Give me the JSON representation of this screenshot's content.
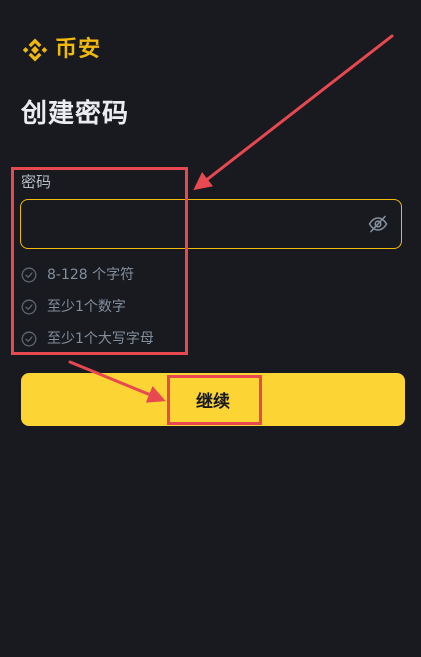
{
  "brand": {
    "name": "币安",
    "logo_icon": "binance-diamond-icon",
    "color": "#F0B90B"
  },
  "page": {
    "title": "创建密码"
  },
  "password": {
    "label": "密码",
    "value": "",
    "visibility_icon": "eye-off-icon",
    "focus_color": "#F0B90B"
  },
  "requirements": [
    {
      "text": "8-128 个字符",
      "met": false
    },
    {
      "text": "至少1个数字",
      "met": false
    },
    {
      "text": "至少1个大写字母",
      "met": false
    }
  ],
  "actions": {
    "continue_label": "继续",
    "button_color": "#FCD535"
  },
  "theme": {
    "background": "#181A20",
    "annotation_color": "#E8484F"
  }
}
